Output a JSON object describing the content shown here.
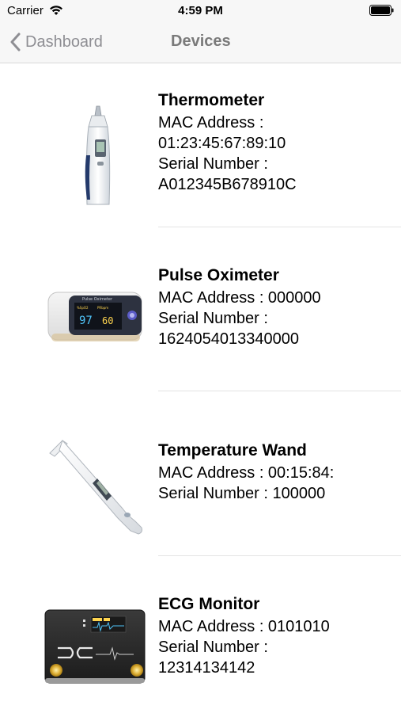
{
  "status_bar": {
    "carrier": "Carrier",
    "time": "4:59 PM"
  },
  "nav": {
    "back_label": "Dashboard",
    "title": "Devices"
  },
  "devices": [
    {
      "name": "Thermometer",
      "mac_line1": "MAC Address :",
      "mac_line2": "01:23:45:67:89:10",
      "serial_line1": "Serial Number :",
      "serial_line2": "A012345B678910C",
      "icon": "ear-thermometer-image"
    },
    {
      "name": "Pulse Oximeter",
      "mac_line1": "MAC Address : 000000",
      "serial_line1": "Serial Number :",
      "serial_line2": "1624054013340000",
      "icon": "pulse-oximeter-image",
      "screen_label": "Pulse Oximeter",
      "screen_spo2": "97",
      "screen_pr": "60",
      "screen_spo2_label": "%SpO2",
      "screen_pr_label": "PRbpm"
    },
    {
      "name": "Temperature Wand",
      "mac_line1": "MAC Address : 00:15:84:",
      "serial_line1": "Serial Number : 100000",
      "icon": "temperature-wand-image"
    },
    {
      "name": "ECG Monitor",
      "mac_line1": "MAC Address : 0101010",
      "serial_line1": "Serial Number :",
      "serial_line2": "12314134142",
      "icon": "ecg-monitor-image"
    }
  ]
}
